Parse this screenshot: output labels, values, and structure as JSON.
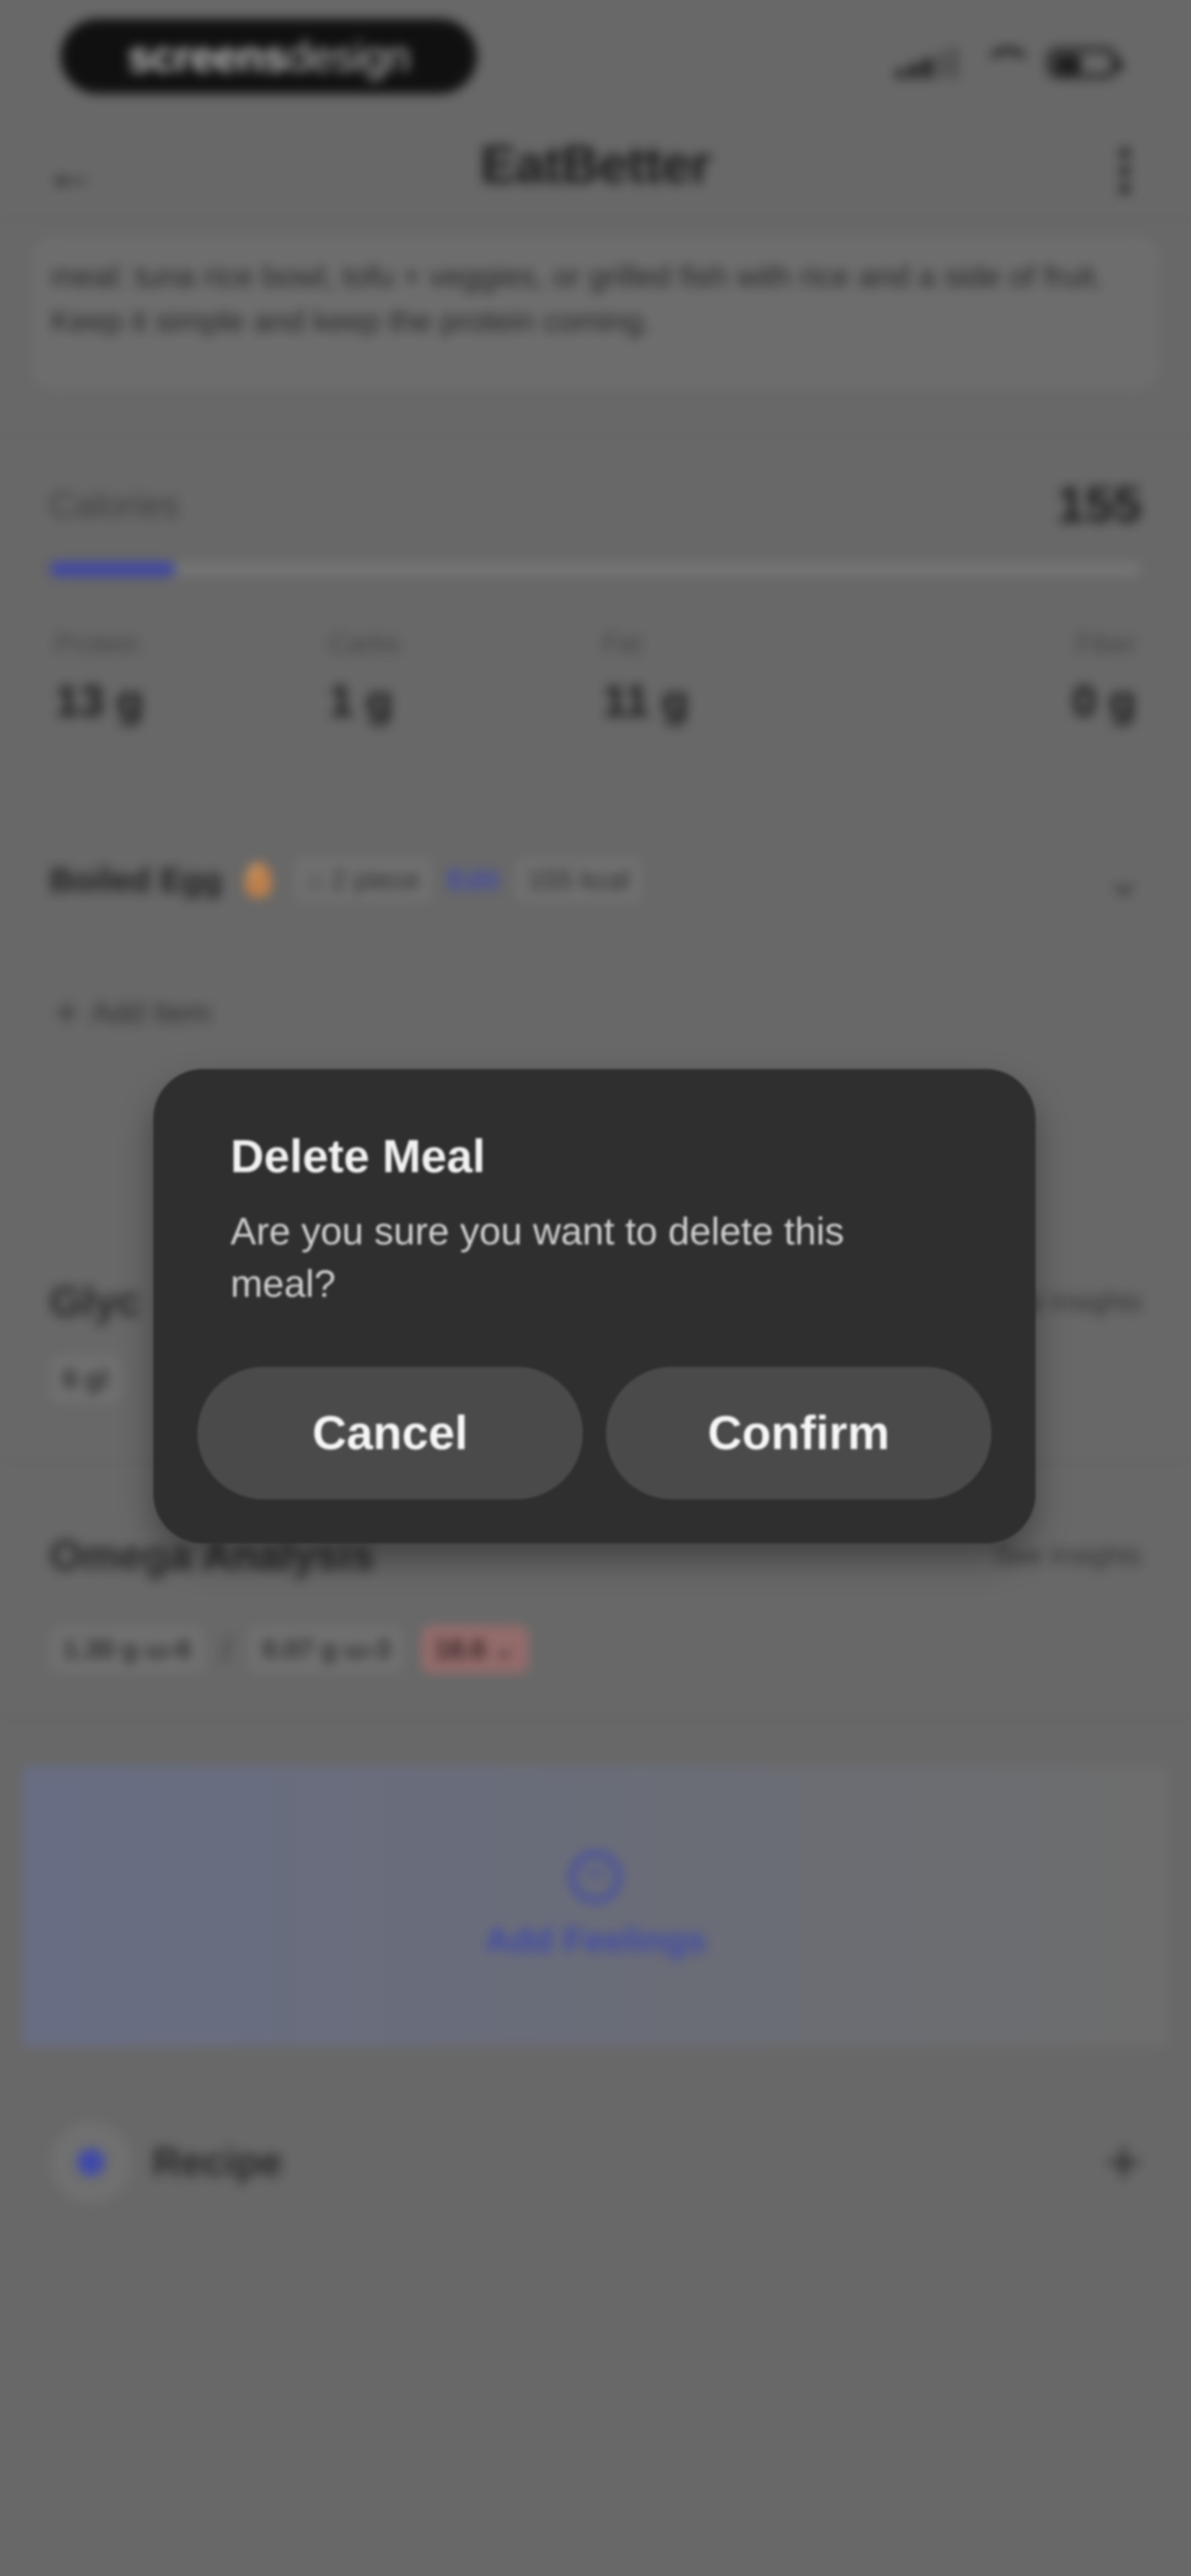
{
  "status_bar": {
    "logo_text_bold": "screens",
    "logo_text_light": "design",
    "icons": [
      "signal-icon",
      "wifi-icon",
      "battery-icon"
    ]
  },
  "app_bar": {
    "title": "EatBetter",
    "back_icon": "back-arrow-icon",
    "menu_icon": "kebab-menu-icon"
  },
  "description": {
    "text": "meal: tuna rice bowl, tofu + veggies, or grilled fish with rice and a side of fruit. Keep it simple and keep the protein coming."
  },
  "nutrition": {
    "calories_label": "Calories",
    "calories_value": "155",
    "calories_progress": 0.115,
    "macros": [
      {
        "label": "Protein",
        "value": "13 g"
      },
      {
        "label": "Carbs",
        "value": "1 g"
      },
      {
        "label": "Fat",
        "value": "11 g"
      },
      {
        "label": "Fiber",
        "value": "0 g"
      }
    ]
  },
  "meal_item": {
    "name": "Boiled Egg",
    "emoji": "🥚",
    "quantity": "2 piece",
    "edit_label": "Edit",
    "kcal": "155 kcal"
  },
  "add_item_label": "Add Item",
  "glycemic": {
    "title": "Glyc",
    "link": "See Insights",
    "chip": "6 gl"
  },
  "omega": {
    "title": "Omega Analysis",
    "link": "See Insights",
    "chips": [
      "1.30 g ω-6",
      "0.07 g ω-3",
      "18.6"
    ],
    "separator": "/"
  },
  "feelings": {
    "label": "Add Feelings"
  },
  "recipe": {
    "label": "Recipe"
  },
  "dialog": {
    "title": "Delete Meal",
    "message": "Are you sure you want to delete this meal?",
    "cancel": "Cancel",
    "confirm": "Confirm"
  },
  "colors": {
    "accent": "#4b58d6",
    "sheet": "#2f2f2f",
    "sheet_button": "#4a4a4a",
    "dim_background": "#7f7f7f"
  }
}
